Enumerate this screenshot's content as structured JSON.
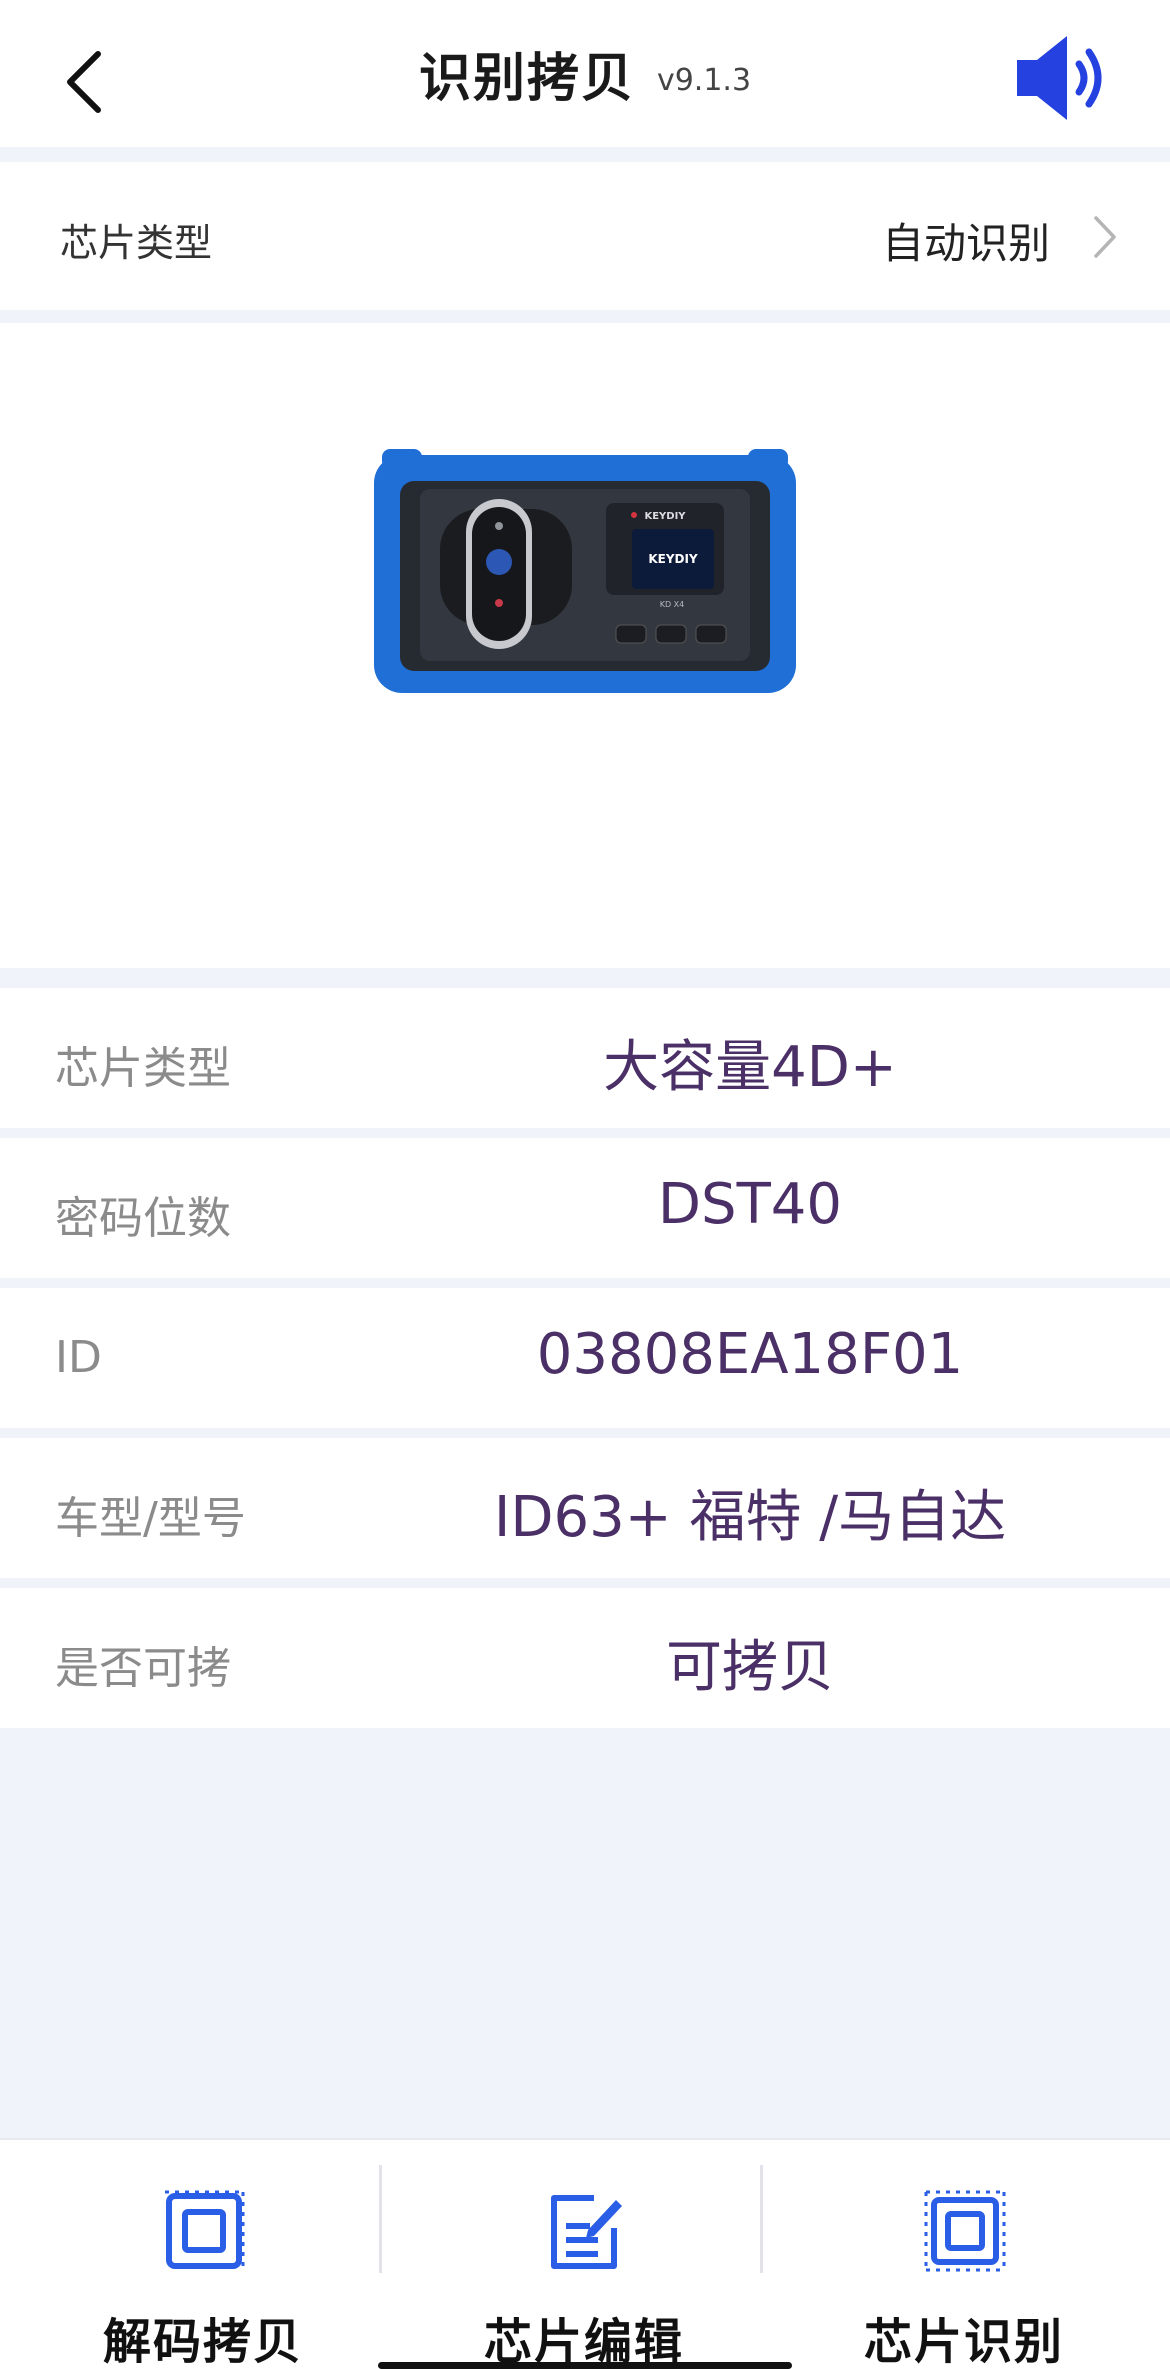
{
  "header": {
    "title": "识别拷贝",
    "version": "v9.1.3",
    "back_icon": "chevron-left-icon",
    "speaker_icon": "speaker-volume-icon",
    "accent_color": "#2541e0"
  },
  "chip_select": {
    "label": "芯片类型",
    "value": "自动识别"
  },
  "device_image": {
    "brand_text": "KEYDIY",
    "screen_text": "KEYDIY",
    "model_text": "KD X4"
  },
  "info": {
    "rows": [
      {
        "label": "芯片类型",
        "value": "大容量4D+"
      },
      {
        "label": "密码位数",
        "value": "DST40"
      },
      {
        "label": "ID",
        "value": "03808EA18F01"
      },
      {
        "label": "车型/型号",
        "value": "ID63+ 福特 /马自达"
      },
      {
        "label": "是否可拷",
        "value": "可拷贝"
      }
    ]
  },
  "tabs": [
    {
      "label": "解码拷贝",
      "icon": "chip-decode-icon"
    },
    {
      "label": "芯片编辑",
      "icon": "edit-document-icon"
    },
    {
      "label": "芯片识别",
      "icon": "chip-scan-icon"
    }
  ]
}
